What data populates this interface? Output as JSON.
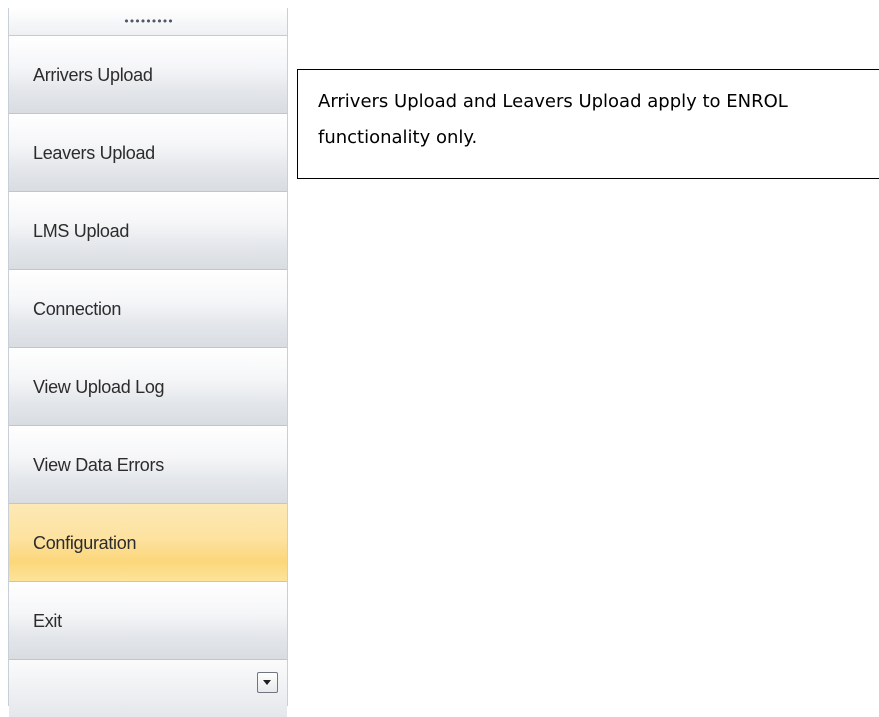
{
  "nav_pane": {
    "grip_label": "•••••••••",
    "items": [
      {
        "label": "Arrivers Upload",
        "selected": false
      },
      {
        "label": "Leavers Upload",
        "selected": false
      },
      {
        "label": "LMS Upload",
        "selected": false
      },
      {
        "label": "Connection",
        "selected": false
      },
      {
        "label": "View Upload Log",
        "selected": false
      },
      {
        "label": "View Data Errors",
        "selected": false
      },
      {
        "label": "Configuration",
        "selected": true
      },
      {
        "label": "Exit",
        "selected": false
      }
    ],
    "overflow_icon": "dropdown-arrow-icon",
    "selected_color": "#fddb8a"
  },
  "note": {
    "text": "Arrivers Upload and Leavers Upload apply to ENROL functionality only."
  }
}
